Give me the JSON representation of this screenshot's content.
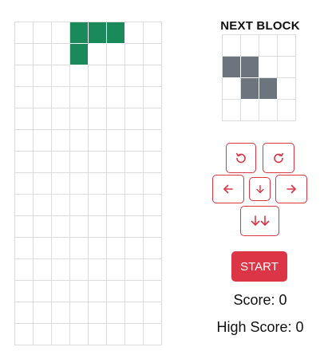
{
  "board": {
    "cols": 8,
    "rows": 15,
    "empty_color": "#ffffff",
    "grid_color": "#dcdcdc",
    "piece_color": "#1a8a5a",
    "filled": [
      [
        3,
        0
      ],
      [
        4,
        0
      ],
      [
        5,
        0
      ],
      [
        3,
        1
      ]
    ]
  },
  "next_block": {
    "title": "NEXT BLOCK",
    "cols": 4,
    "rows": 4,
    "color": "#6c757d",
    "filled": [
      [
        0,
        1
      ],
      [
        1,
        1
      ],
      [
        1,
        2
      ],
      [
        2,
        2
      ]
    ]
  },
  "controls": {
    "rotate_left_icon": "rotate-ccw",
    "rotate_right_icon": "rotate-cw",
    "left_icon": "arrow-left",
    "down_icon": "arrow-down",
    "right_icon": "arrow-right",
    "drop_icon": "double-arrow-down",
    "accent_color": "#dc3545"
  },
  "start_label": "START",
  "score": "Score: 0",
  "high_score": "High Score: 0"
}
